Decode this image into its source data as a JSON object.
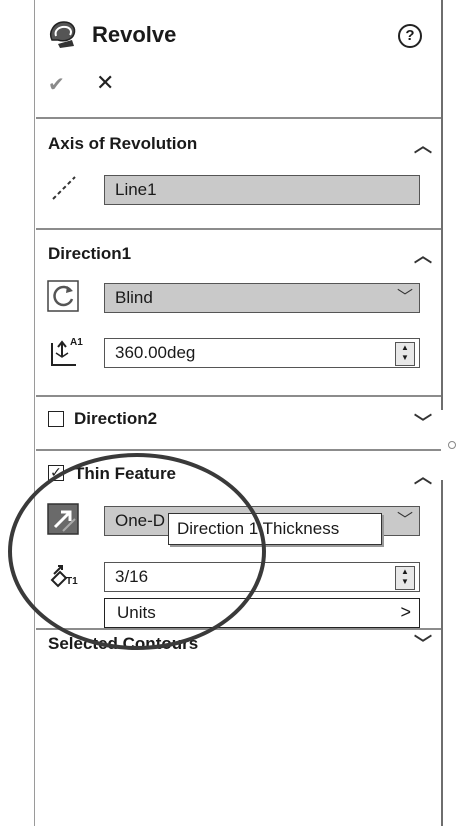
{
  "header": {
    "title": "Revolve",
    "help_glyph": "?",
    "ok_glyph": "✔",
    "cancel_glyph": "✕"
  },
  "axis": {
    "title": "Axis of Revolution",
    "value": "Line1"
  },
  "direction1": {
    "title": "Direction1",
    "end_condition": "Blind",
    "angle": "360.00deg",
    "angle_icon_label": "A1"
  },
  "direction2": {
    "title": "Direction2",
    "checked": false
  },
  "thin": {
    "title": "Thin Feature",
    "checked": true,
    "check_glyph": "✓",
    "type_value": "One-D",
    "thickness": "3/16",
    "thickness_icon_label": "T1"
  },
  "tooltip": {
    "text": "Direction 1 Thickness"
  },
  "units_menu": {
    "label": "Units",
    "arrow": ">"
  },
  "selected_contours": {
    "title": "Selected Contours"
  },
  "icons": [
    "revolve-logo-icon",
    "help-icon",
    "ok-check-icon",
    "cancel-x-icon",
    "axis-line-icon",
    "reverse-direction-icon",
    "angle-icon",
    "flip-direction-icon",
    "thickness-icon",
    "chevron-up-icon",
    "chevron-down-icon"
  ],
  "colors": {
    "field_gray": "#c9c9c9",
    "annotation_circle": "#3a3a3a"
  }
}
